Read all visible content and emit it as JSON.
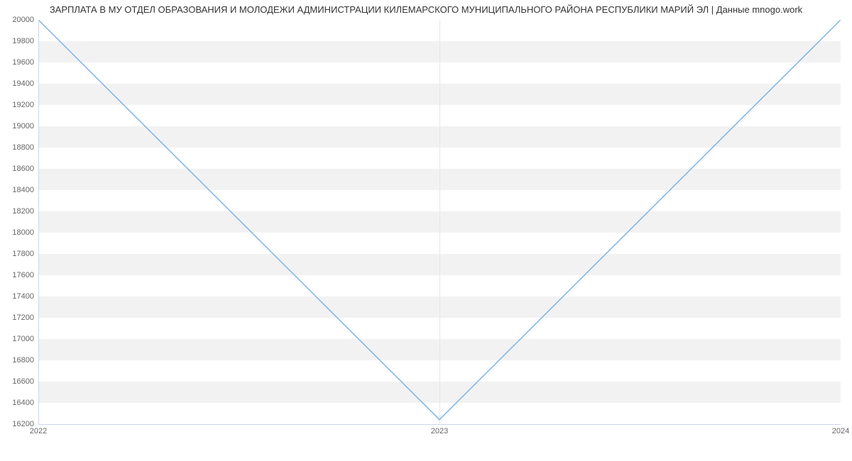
{
  "chart_data": {
    "type": "line",
    "title": "ЗАРПЛАТА В МУ ОТДЕЛ ОБРАЗОВАНИЯ И МОЛОДЕЖИ АДМИНИСТРАЦИИ КИЛЕМАРСКОГО МУНИЦИПАЛЬНОГО РАЙОНА РЕСПУБЛИКИ МАРИЙ ЭЛ | Данные mnogo.work",
    "x": [
      "2022",
      "2023",
      "2024"
    ],
    "values": [
      20000,
      16242,
      20000
    ],
    "xlabel": "",
    "ylabel": "",
    "ylim": [
      16200,
      20000
    ],
    "y_ticks": [
      16200,
      16400,
      16600,
      16800,
      17000,
      17200,
      17400,
      17600,
      17800,
      18000,
      18200,
      18400,
      18600,
      18800,
      19000,
      19200,
      19400,
      19600,
      19800,
      20000
    ],
    "x_ticks": [
      "2022",
      "2023",
      "2024"
    ]
  }
}
